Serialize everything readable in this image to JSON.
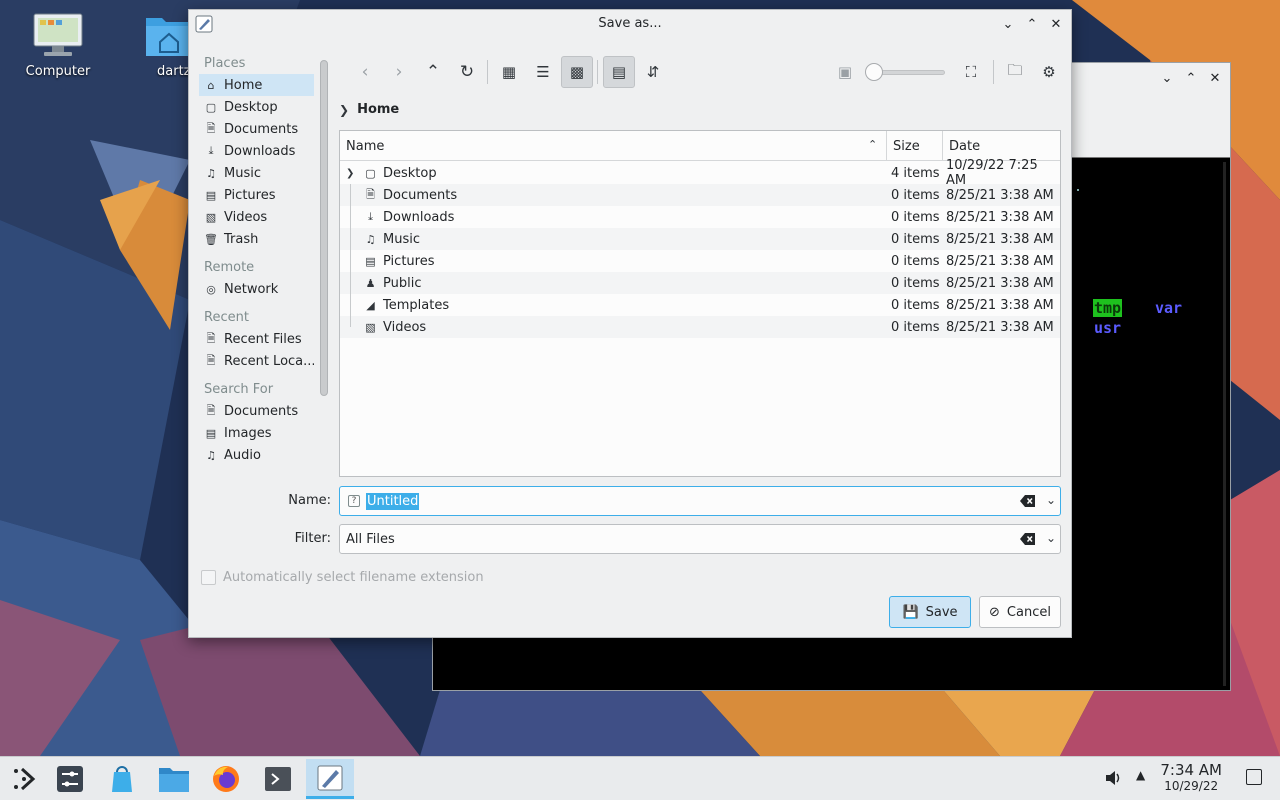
{
  "desktop": {
    "icons": [
      {
        "label": "Computer",
        "icon": "computer-icon"
      },
      {
        "label": "dartz",
        "icon": "home-folder-icon"
      }
    ]
  },
  "terminal": {
    "lines": [
      {
        "text": "tmp",
        "color": "#1ec11e",
        "bg": "#1ec11e"
      },
      {
        "text": "var",
        "color": "#5b5bff"
      },
      {
        "text": "usr",
        "color": "#5b5bff"
      }
    ]
  },
  "dialog": {
    "title": "Save as...",
    "places": {
      "sections": [
        {
          "heading": "Places",
          "items": [
            {
              "label": "Home",
              "icon": "home-icon",
              "active": true
            },
            {
              "label": "Desktop",
              "icon": "desktop-icon"
            },
            {
              "label": "Documents",
              "icon": "documents-icon"
            },
            {
              "label": "Downloads",
              "icon": "downloads-icon"
            },
            {
              "label": "Music",
              "icon": "music-icon"
            },
            {
              "label": "Pictures",
              "icon": "pictures-icon"
            },
            {
              "label": "Videos",
              "icon": "videos-icon"
            },
            {
              "label": "Trash",
              "icon": "trash-icon"
            }
          ]
        },
        {
          "heading": "Remote",
          "items": [
            {
              "label": "Network",
              "icon": "network-icon"
            }
          ]
        },
        {
          "heading": "Recent",
          "items": [
            {
              "label": "Recent Files",
              "icon": "recent-files-icon"
            },
            {
              "label": "Recent Loca...",
              "icon": "recent-locations-icon"
            }
          ]
        },
        {
          "heading": "Search For",
          "items": [
            {
              "label": "Documents",
              "icon": "documents-icon"
            },
            {
              "label": "Images",
              "icon": "images-icon"
            },
            {
              "label": "Audio",
              "icon": "audio-icon"
            }
          ]
        }
      ]
    },
    "breadcrumb": "Home",
    "columns": {
      "name": "Name",
      "size": "Size",
      "date": "Date"
    },
    "files": [
      {
        "name": "Desktop",
        "size": "4 items",
        "date": "10/29/22 7:25 AM",
        "icon": "desktop-icon",
        "expandable": true
      },
      {
        "name": "Documents",
        "size": "0 items",
        "date": "8/25/21 3:38 AM",
        "icon": "documents-icon"
      },
      {
        "name": "Downloads",
        "size": "0 items",
        "date": "8/25/21 3:38 AM",
        "icon": "downloads-icon"
      },
      {
        "name": "Music",
        "size": "0 items",
        "date": "8/25/21 3:38 AM",
        "icon": "music-icon"
      },
      {
        "name": "Pictures",
        "size": "0 items",
        "date": "8/25/21 3:38 AM",
        "icon": "pictures-icon"
      },
      {
        "name": "Public",
        "size": "0 items",
        "date": "8/25/21 3:38 AM",
        "icon": "public-icon"
      },
      {
        "name": "Templates",
        "size": "0 items",
        "date": "8/25/21 3:38 AM",
        "icon": "templates-icon"
      },
      {
        "name": "Videos",
        "size": "0 items",
        "date": "8/25/21 3:38 AM",
        "icon": "videos-icon"
      }
    ],
    "name_label": "Name:",
    "name_value": "Untitled",
    "filter_label": "Filter:",
    "filter_value": "All Files",
    "auto_extension_label": "Automatically select filename extension",
    "save_label": "Save",
    "cancel_label": "Cancel"
  },
  "taskbar": {
    "time": "7:34 AM",
    "date": "10/29/22"
  },
  "colors": {
    "accent": "#3daee9",
    "selection_bg": "#cfe5f5"
  }
}
